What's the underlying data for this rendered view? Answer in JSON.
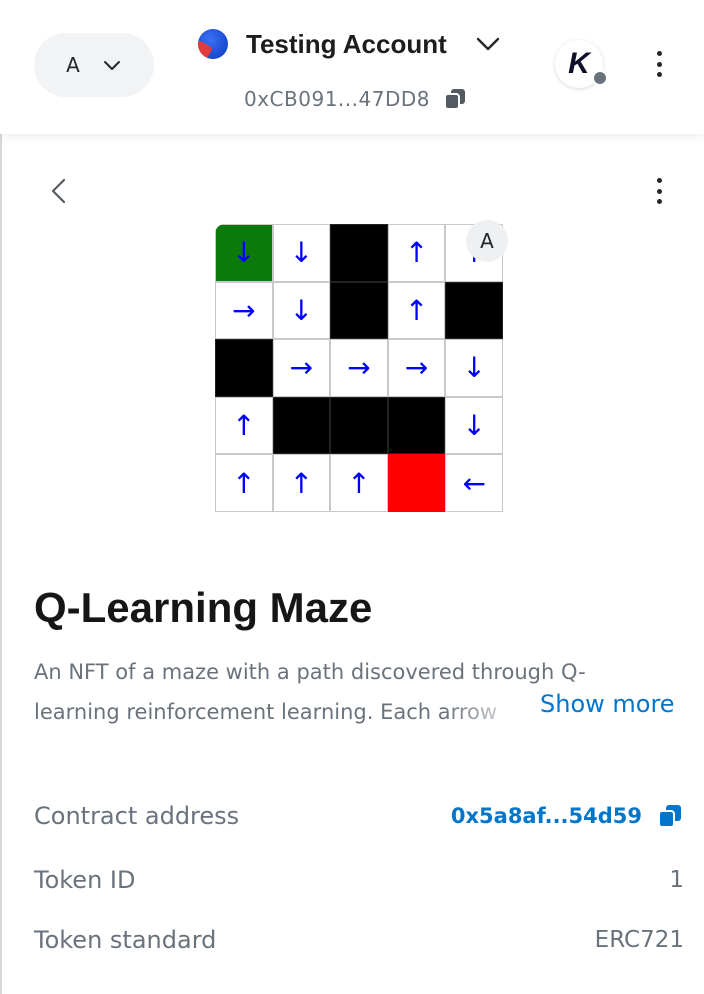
{
  "header": {
    "network_letter": "A",
    "account_name": "Testing Account",
    "account_address": "0xCB091...47DD8"
  },
  "maze": {
    "badge_letter": "A",
    "cells": [
      [
        {
          "kind": "start",
          "arrow": "↓"
        },
        {
          "kind": "path",
          "arrow": "↓"
        },
        {
          "kind": "wall",
          "arrow": ""
        },
        {
          "kind": "path",
          "arrow": "↑"
        },
        {
          "kind": "path",
          "arrow": "↑"
        }
      ],
      [
        {
          "kind": "path",
          "arrow": "→"
        },
        {
          "kind": "path",
          "arrow": "↓"
        },
        {
          "kind": "wall",
          "arrow": ""
        },
        {
          "kind": "path",
          "arrow": "↑"
        },
        {
          "kind": "wall",
          "arrow": ""
        }
      ],
      [
        {
          "kind": "wall",
          "arrow": ""
        },
        {
          "kind": "path",
          "arrow": "→"
        },
        {
          "kind": "path",
          "arrow": "→"
        },
        {
          "kind": "path",
          "arrow": "→"
        },
        {
          "kind": "path",
          "arrow": "↓"
        }
      ],
      [
        {
          "kind": "path",
          "arrow": "↑"
        },
        {
          "kind": "wall",
          "arrow": ""
        },
        {
          "kind": "wall",
          "arrow": ""
        },
        {
          "kind": "wall",
          "arrow": ""
        },
        {
          "kind": "path",
          "arrow": "↓"
        }
      ],
      [
        {
          "kind": "path",
          "arrow": "↑"
        },
        {
          "kind": "path",
          "arrow": "↑"
        },
        {
          "kind": "path",
          "arrow": "↑"
        },
        {
          "kind": "goal",
          "arrow": ""
        },
        {
          "kind": "path",
          "arrow": "←"
        }
      ]
    ],
    "colors": {
      "start": "#0b7a0b",
      "goal": "#ff0000",
      "wall": "#000000",
      "arrow": "#0000ff"
    }
  },
  "nft": {
    "title": "Q-Learning Maze",
    "description_line1": "An NFT of a maze with a path discovered through Q-",
    "description_line2": "learning reinforcement learning. Each arrow",
    "show_more": "Show more"
  },
  "details": {
    "contract_label": "Contract address",
    "contract_value": "0x5a8af...54d59",
    "token_id_label": "Token ID",
    "token_id_value": "1",
    "token_standard_label": "Token standard",
    "token_standard_value": "ERC721"
  },
  "icons": {
    "network_chevron": "chevron-down-icon",
    "account_chevron": "chevron-down-icon",
    "copy": "copy-icon",
    "back": "chevron-left-icon",
    "menu": "kebab-menu-icon"
  },
  "colors": {
    "link": "#0376c9",
    "muted_text": "#6a737d",
    "title_text": "#141618"
  }
}
